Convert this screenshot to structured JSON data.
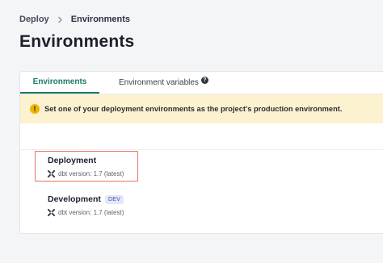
{
  "breadcrumb": {
    "parent": "Deploy",
    "current": "Environments"
  },
  "page": {
    "title": "Environments"
  },
  "tabs": [
    {
      "label": "Environments",
      "active": true
    },
    {
      "label": "Environment variables",
      "active": false,
      "icon": "help-icon"
    }
  ],
  "banner": {
    "icon": "warning-icon",
    "text": "Set one of your deployment environments as the project's production environment."
  },
  "environments": [
    {
      "name": "Deployment",
      "version": "dbt version: 1.7 (latest)",
      "badge": ""
    },
    {
      "name": "Development",
      "version": "dbt version: 1.7 (latest)",
      "badge": "DEV"
    }
  ],
  "colors": {
    "accent": "#1d7a6a",
    "banner_bg": "#fdf2cf",
    "warning": "#f0b400",
    "highlight_border": "#e9735d",
    "badge_bg": "#e3e7fa",
    "badge_text": "#3f4fa8"
  }
}
